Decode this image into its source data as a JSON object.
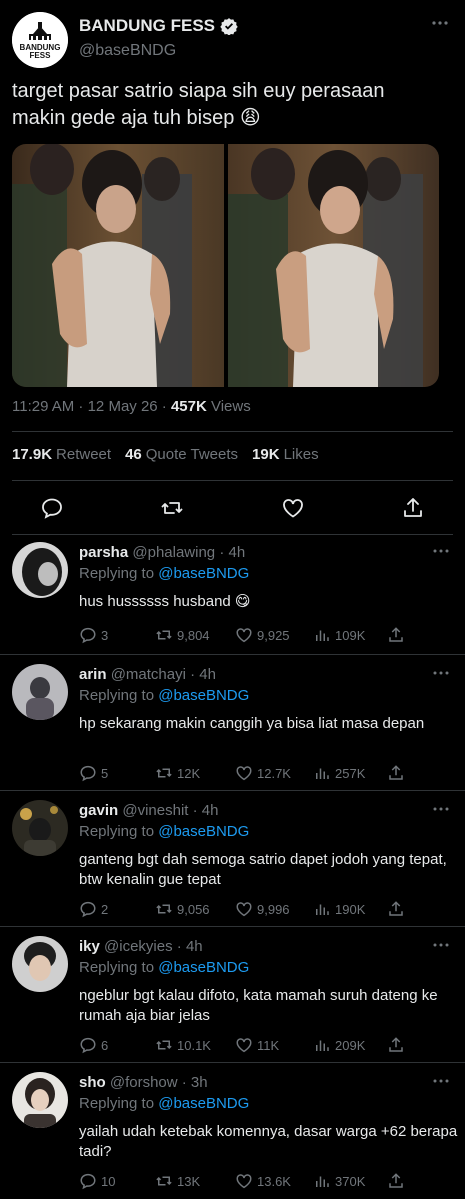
{
  "account": {
    "name": "BANDUNG FESS",
    "handle": "@baseBNDG",
    "logo_line1": "BANDUNG",
    "logo_line2": "FESS"
  },
  "tweet": {
    "text": "target pasar satrio siapa sih euy perasaan makin gede aja tuh bisep 😩",
    "time": "11:29 AM · 12 May 26 · ",
    "views_count": "457K",
    "views_label": " Views",
    "retweets_count": "17.9K",
    "retweets_label": "Retweet",
    "quotes_count": "46",
    "quotes_label": "Quote Tweets",
    "likes_count": "19K",
    "likes_label": "Likes"
  },
  "replies": [
    {
      "name": "parsha",
      "handle": "@phalawing · 4h",
      "replying_prefix": "Replying to ",
      "replying_to": "@baseBNDG",
      "text": "hus hussssss husband 😋",
      "comments": "3",
      "retweets": "9,804",
      "likes": "9,925",
      "views": "109K"
    },
    {
      "name": "arin",
      "handle": "@matchayi · 4h",
      "replying_prefix": "Replying to ",
      "replying_to": "@baseBNDG",
      "text": "hp sekarang makin canggih ya bisa liat masa depan",
      "comments": "5",
      "retweets": "12K",
      "likes": "12.7K",
      "views": "257K"
    },
    {
      "name": "gavin",
      "handle": "@vineshit · 4h",
      "replying_prefix": "Replying to ",
      "replying_to": "@baseBNDG",
      "text": "ganteng bgt dah semoga satrio dapet jodoh yang tepat, btw kenalin gue tepat",
      "comments": "2",
      "retweets": "9,056",
      "likes": "9,996",
      "views": "190K"
    },
    {
      "name": "iky",
      "handle": "@icekyies · 4h",
      "replying_prefix": "Replying to ",
      "replying_to": "@baseBNDG",
      "text": "ngeblur bgt kalau difoto, kata mamah suruh dateng ke rumah aja biar jelas",
      "comments": "6",
      "retweets": "10.1K",
      "likes": "11K",
      "views": "209K"
    },
    {
      "name": "sho",
      "handle": "@forshow · 3h",
      "replying_prefix": "Replying to ",
      "replying_to": "@baseBNDG",
      "text": "yailah udah ketebak komennya, dasar warga +62 berapa tadi?",
      "comments": "10",
      "retweets": "13K",
      "likes": "13.6K",
      "views": "370K"
    }
  ],
  "colors": {
    "background": "#000000",
    "text": "#e7e9ea",
    "muted": "#71767b",
    "link": "#1d9bf0",
    "divider": "#2f3336"
  }
}
